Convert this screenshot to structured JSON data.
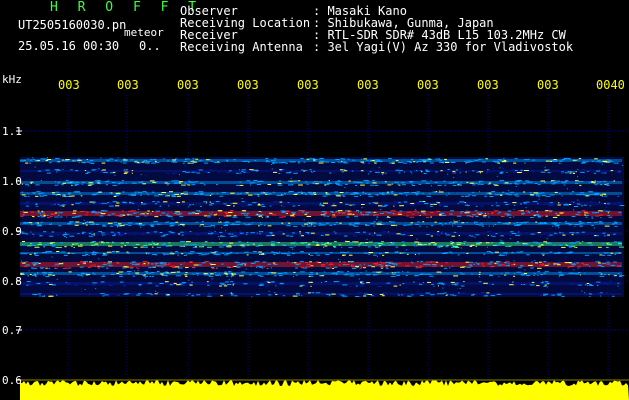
{
  "header": {
    "app_title": "H R O F F T",
    "filename": "UT2505160030.pn",
    "type_label": "meteor",
    "date_time": "25.05.16 00:30",
    "count": "0..",
    "fields": [
      {
        "label": "Observer",
        "value": ": Masaki Kano"
      },
      {
        "label": "Receiving Location",
        "value": ": Shibukawa, Gunma, Japan"
      },
      {
        "label": "Receiver",
        "value": ": RTL-SDR SDR# 43dB L15 103.2MHz CW"
      },
      {
        "label": "Receiving Antenna",
        "value": ": 3el Yagi(V) Az 330 for Vladivostok"
      }
    ]
  },
  "axis": {
    "unit": "kHz",
    "y_labels": [
      "1.1",
      "1.0",
      "0.9",
      "0.8",
      "0.7",
      "0.6"
    ],
    "time_labels": [
      "003",
      "003",
      "003",
      "003",
      "003",
      "003",
      "003",
      "003",
      "003",
      "0040"
    ]
  },
  "colors": {
    "background": "#000000",
    "title_green": "#3cff3c",
    "time_yellow": "#ffff00",
    "grid_blue": "#0000aa",
    "signal_low": "#0a1aa0",
    "signal_mid": "#00a0ff",
    "signal_high": "#ff2020",
    "amplitude_yellow": "#ffff00"
  }
}
